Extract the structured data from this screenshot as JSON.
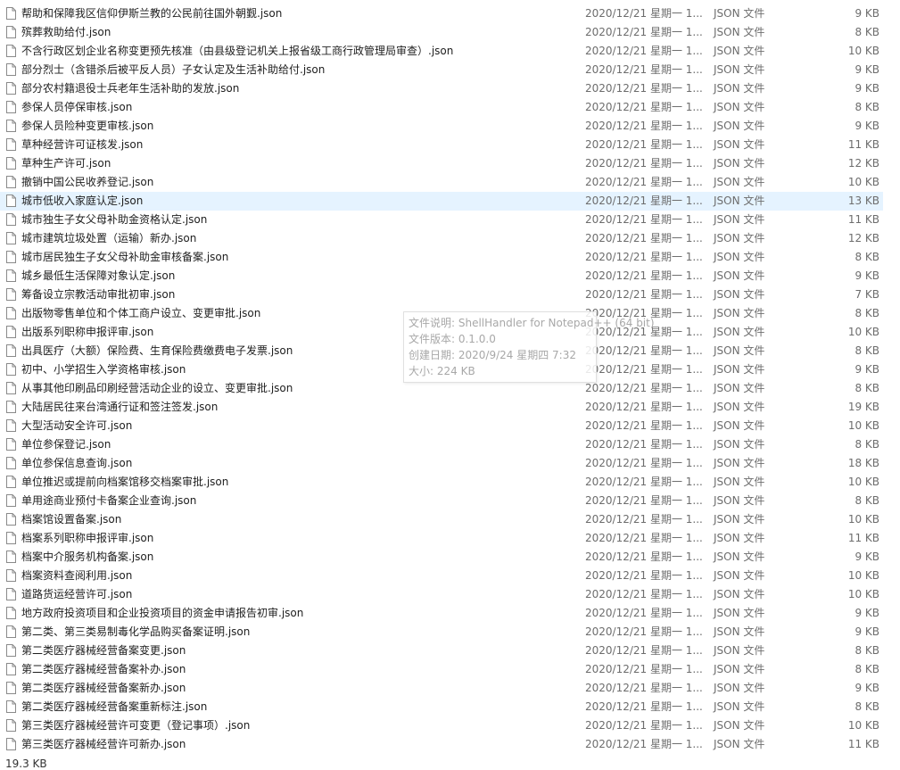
{
  "files": [
    {
      "name": "帮助和保障我区信仰伊斯兰教的公民前往国外朝觐.json",
      "date": "2020/12/21 星期一 1...",
      "type": "JSON 文件",
      "size": "9 KB"
    },
    {
      "name": "殡葬救助给付.json",
      "date": "2020/12/21 星期一 1...",
      "type": "JSON 文件",
      "size": "8 KB"
    },
    {
      "name": "不含行政区划企业名称变更预先核准（由县级登记机关上报省级工商行政管理局审查）.json",
      "date": "2020/12/21 星期一 1...",
      "type": "JSON 文件",
      "size": "10 KB"
    },
    {
      "name": "部分烈士（含错杀后被平反人员）子女认定及生活补助给付.json",
      "date": "2020/12/21 星期一 1...",
      "type": "JSON 文件",
      "size": "9 KB"
    },
    {
      "name": "部分农村籍退役士兵老年生活补助的发放.json",
      "date": "2020/12/21 星期一 1...",
      "type": "JSON 文件",
      "size": "9 KB"
    },
    {
      "name": "参保人员停保审核.json",
      "date": "2020/12/21 星期一 1...",
      "type": "JSON 文件",
      "size": "8 KB"
    },
    {
      "name": "参保人员险种变更审核.json",
      "date": "2020/12/21 星期一 1...",
      "type": "JSON 文件",
      "size": "9 KB"
    },
    {
      "name": "草种经营许可证核发.json",
      "date": "2020/12/21 星期一 1...",
      "type": "JSON 文件",
      "size": "11 KB"
    },
    {
      "name": "草种生产许可.json",
      "date": "2020/12/21 星期一 1...",
      "type": "JSON 文件",
      "size": "12 KB"
    },
    {
      "name": "撤销中国公民收养登记.json",
      "date": "2020/12/21 星期一 1...",
      "type": "JSON 文件",
      "size": "10 KB"
    },
    {
      "name": "城市低收入家庭认定.json",
      "date": "2020/12/21 星期一 1...",
      "type": "JSON 文件",
      "size": "13 KB"
    },
    {
      "name": "城市独生子女父母补助金资格认定.json",
      "date": "2020/12/21 星期一 1...",
      "type": "JSON 文件",
      "size": "11 KB"
    },
    {
      "name": "城市建筑垃圾处置（运输）新办.json",
      "date": "2020/12/21 星期一 1...",
      "type": "JSON 文件",
      "size": "12 KB"
    },
    {
      "name": "城市居民独生子女父母补助金审核备案.json",
      "date": "2020/12/21 星期一 1...",
      "type": "JSON 文件",
      "size": "8 KB"
    },
    {
      "name": "城乡最低生活保障对象认定.json",
      "date": "2020/12/21 星期一 1...",
      "type": "JSON 文件",
      "size": "9 KB"
    },
    {
      "name": "筹备设立宗教活动审批初审.json",
      "date": "2020/12/21 星期一 1...",
      "type": "JSON 文件",
      "size": "7 KB"
    },
    {
      "name": "出版物零售单位和个体工商户设立、变更审批.json",
      "date": "2020/12/21 星期一 1...",
      "type": "JSON 文件",
      "size": "8 KB"
    },
    {
      "name": "出版系列职称申报评审.json",
      "date": "2020/12/21 星期一 1...",
      "type": "JSON 文件",
      "size": "10 KB"
    },
    {
      "name": "出具医疗（大额）保险费、生育保险费缴费电子发票.json",
      "date": "2020/12/21 星期一 1...",
      "type": "JSON 文件",
      "size": "8 KB"
    },
    {
      "name": "初中、小学招生入学资格审核.json",
      "date": "2020/12/21 星期一 1...",
      "type": "JSON 文件",
      "size": "9 KB"
    },
    {
      "name": "从事其他印刷品印刷经营活动企业的设立、变更审批.json",
      "date": "2020/12/21 星期一 1...",
      "type": "JSON 文件",
      "size": "8 KB"
    },
    {
      "name": "大陆居民往来台湾通行证和签注签发.json",
      "date": "2020/12/21 星期一 1...",
      "type": "JSON 文件",
      "size": "19 KB"
    },
    {
      "name": "大型活动安全许可.json",
      "date": "2020/12/21 星期一 1...",
      "type": "JSON 文件",
      "size": "10 KB"
    },
    {
      "name": "单位参保登记.json",
      "date": "2020/12/21 星期一 1...",
      "type": "JSON 文件",
      "size": "8 KB"
    },
    {
      "name": "单位参保信息查询.json",
      "date": "2020/12/21 星期一 1...",
      "type": "JSON 文件",
      "size": "18 KB"
    },
    {
      "name": "单位推迟或提前向档案馆移交档案审批.json",
      "date": "2020/12/21 星期一 1...",
      "type": "JSON 文件",
      "size": "10 KB"
    },
    {
      "name": "单用途商业预付卡备案企业查询.json",
      "date": "2020/12/21 星期一 1...",
      "type": "JSON 文件",
      "size": "8 KB"
    },
    {
      "name": "档案馆设置备案.json",
      "date": "2020/12/21 星期一 1...",
      "type": "JSON 文件",
      "size": "10 KB"
    },
    {
      "name": "档案系列职称申报评审.json",
      "date": "2020/12/21 星期一 1...",
      "type": "JSON 文件",
      "size": "11 KB"
    },
    {
      "name": "档案中介服务机构备案.json",
      "date": "2020/12/21 星期一 1...",
      "type": "JSON 文件",
      "size": "9 KB"
    },
    {
      "name": "档案资料查阅利用.json",
      "date": "2020/12/21 星期一 1...",
      "type": "JSON 文件",
      "size": "10 KB"
    },
    {
      "name": "道路货运经营许可.json",
      "date": "2020/12/21 星期一 1...",
      "type": "JSON 文件",
      "size": "10 KB"
    },
    {
      "name": "地方政府投资项目和企业投资项目的资金申请报告初审.json",
      "date": "2020/12/21 星期一 1...",
      "type": "JSON 文件",
      "size": "9 KB"
    },
    {
      "name": "第二类、第三类易制毒化学品购买备案证明.json",
      "date": "2020/12/21 星期一 1...",
      "type": "JSON 文件",
      "size": "9 KB"
    },
    {
      "name": "第二类医疗器械经营备案变更.json",
      "date": "2020/12/21 星期一 1...",
      "type": "JSON 文件",
      "size": "8 KB"
    },
    {
      "name": "第二类医疗器械经营备案补办.json",
      "date": "2020/12/21 星期一 1...",
      "type": "JSON 文件",
      "size": "8 KB"
    },
    {
      "name": "第二类医疗器械经营备案新办.json",
      "date": "2020/12/21 星期一 1...",
      "type": "JSON 文件",
      "size": "9 KB"
    },
    {
      "name": "第二类医疗器械经营备案重新标注.json",
      "date": "2020/12/21 星期一 1...",
      "type": "JSON 文件",
      "size": "8 KB"
    },
    {
      "name": "第三类医疗器械经营许可变更（登记事项）.json",
      "date": "2020/12/21 星期一 1...",
      "type": "JSON 文件",
      "size": "10 KB"
    },
    {
      "name": "第三类医疗器械经营许可新办.json",
      "date": "2020/12/21 星期一 1...",
      "type": "JSON 文件",
      "size": "11 KB"
    }
  ],
  "selected_index": 10,
  "tooltip": {
    "description": "文件说明: ShellHandler for Notepad++ (64 bit)",
    "version": "文件版本: 0.1.0.0",
    "created": "创建日期: 2020/9/24 星期四 7:32",
    "size": "大小: 224 KB"
  },
  "status_bar": {
    "selected_size": "19.3 KB"
  },
  "colors": {
    "selected_row": "#e5f3ff",
    "secondary_text": "#6d6d6d"
  }
}
